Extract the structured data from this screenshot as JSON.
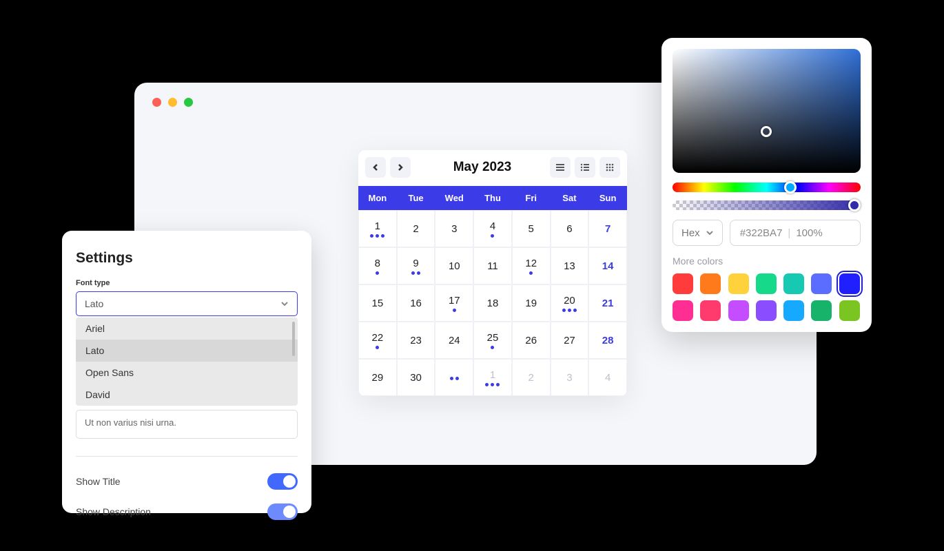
{
  "window": {
    "traffic": [
      "close",
      "minimize",
      "maximize"
    ]
  },
  "calendar": {
    "title": "May 2023",
    "weekdays": [
      "Mon",
      "Tue",
      "Wed",
      "Thu",
      "Fri",
      "Sat",
      "Sun"
    ],
    "days": [
      {
        "n": "1",
        "dots": 3
      },
      {
        "n": "2"
      },
      {
        "n": "3"
      },
      {
        "n": "4",
        "dots": 1
      },
      {
        "n": "5"
      },
      {
        "n": "6"
      },
      {
        "n": "7",
        "sun": true
      },
      {
        "n": "8",
        "dots": 1
      },
      {
        "n": "9",
        "dots": 2
      },
      {
        "n": "10"
      },
      {
        "n": "11"
      },
      {
        "n": "12",
        "dots": 1
      },
      {
        "n": "13"
      },
      {
        "n": "14",
        "sun": true
      },
      {
        "n": "15"
      },
      {
        "n": "16"
      },
      {
        "n": "17",
        "dots": 1
      },
      {
        "n": "18"
      },
      {
        "n": "19"
      },
      {
        "n": "20",
        "dots": 3
      },
      {
        "n": "21",
        "sun": true
      },
      {
        "n": "22",
        "dots": 1
      },
      {
        "n": "23"
      },
      {
        "n": "24"
      },
      {
        "n": "25",
        "dots": 1
      },
      {
        "n": "26"
      },
      {
        "n": "27"
      },
      {
        "n": "28",
        "sun": true
      },
      {
        "n": "29"
      },
      {
        "n": "30"
      },
      {
        "n": "",
        "dots": 2,
        "out": true
      },
      {
        "n": "1",
        "dots": 3,
        "out": true
      },
      {
        "n": "2",
        "out": true
      },
      {
        "n": "3",
        "out": true
      },
      {
        "n": "4",
        "out": true
      }
    ]
  },
  "settings": {
    "title": "Settings",
    "font_label": "Font type",
    "font_value": "Lato",
    "options": [
      "Ariel",
      "Lato",
      "Open Sans",
      "David"
    ],
    "selected_option": "Lato",
    "textarea_value": "Ut non varius nisi urna.",
    "show_title_label": "Show Title",
    "show_description_label": "Show Description"
  },
  "picker": {
    "format": "Hex",
    "hex_value": "#322BA7",
    "alpha": "100%",
    "more_label": "More colors",
    "swatches": [
      "#ff3b3b",
      "#ff7a1a",
      "#ffd23b",
      "#16d98a",
      "#17c9b2",
      "#5b6dff",
      "#2020ff",
      "#ff2e92",
      "#ff3b6e",
      "#c34dff",
      "#8a4dff",
      "#17a8ff",
      "#18b36b",
      "#7ac522"
    ],
    "selected_swatch_index": 6
  }
}
